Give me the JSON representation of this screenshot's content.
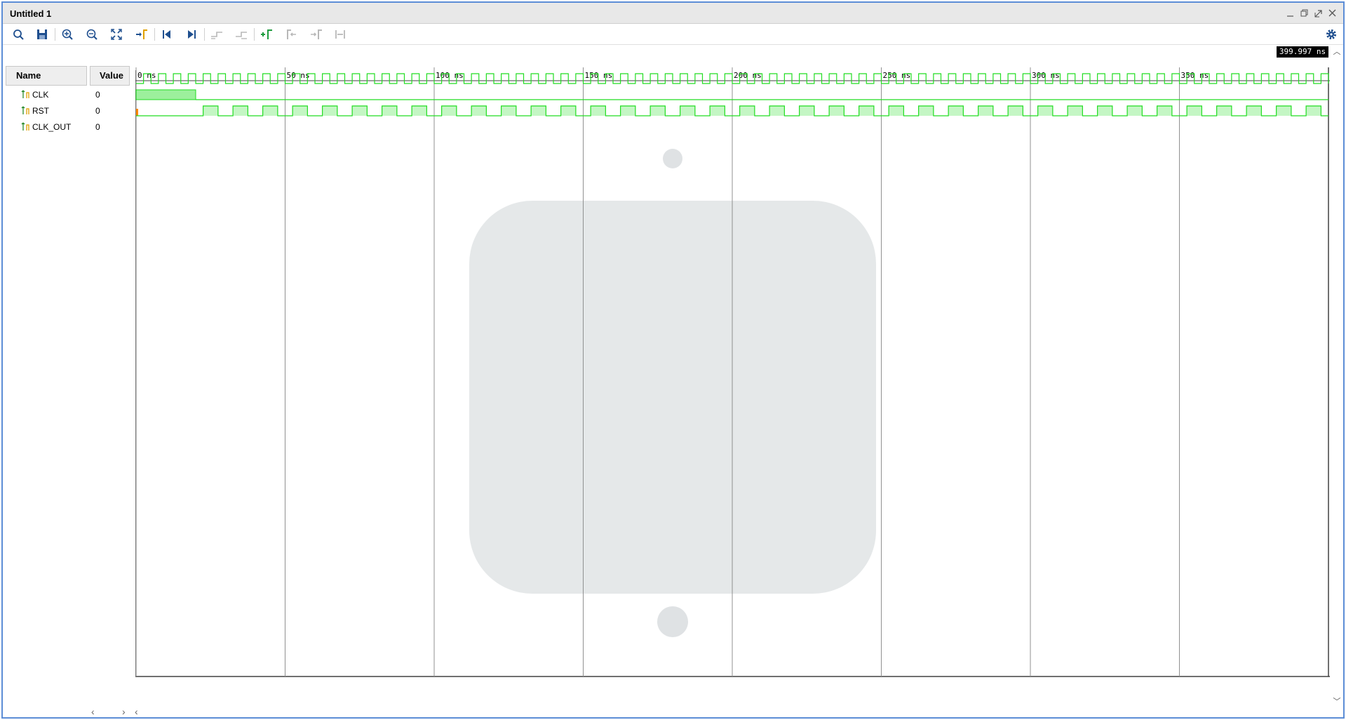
{
  "window": {
    "title": "Untitled 1",
    "controls": [
      "minimize-icon",
      "restore-icon",
      "maximize-icon",
      "close-icon"
    ]
  },
  "toolbar": {
    "buttons": [
      {
        "name": "search-icon",
        "enabled": true
      },
      {
        "name": "save-icon",
        "enabled": true
      },
      {
        "name": "zoom-in-icon",
        "enabled": true
      },
      {
        "name": "zoom-out-icon",
        "enabled": true
      },
      {
        "name": "zoom-fit-icon",
        "enabled": true
      },
      {
        "name": "go-to-cursor-icon",
        "enabled": true
      },
      {
        "name": "go-to-start-icon",
        "enabled": true
      },
      {
        "name": "go-to-end-icon",
        "enabled": true
      },
      {
        "name": "previous-transition-icon",
        "enabled": false
      },
      {
        "name": "next-transition-icon",
        "enabled": false
      },
      {
        "name": "add-marker-icon",
        "enabled": true
      },
      {
        "name": "previous-marker-icon",
        "enabled": false
      },
      {
        "name": "next-marker-icon",
        "enabled": false
      },
      {
        "name": "swap-cursors-icon",
        "enabled": false
      }
    ],
    "settings_icon": "gear-icon"
  },
  "cursor_time": "399.997 ns",
  "columns": {
    "name": "Name",
    "value": "Value"
  },
  "signals": [
    {
      "name": "CLK",
      "value": "0"
    },
    {
      "name": "RST",
      "value": "0"
    },
    {
      "name": "CLK_OUT",
      "value": "0"
    }
  ],
  "timeline": {
    "unit": "ns",
    "start": 0,
    "end": 400,
    "major_step": 50,
    "labels": [
      "0 ns",
      "50 ns",
      "100 ns",
      "150 ns",
      "200 ns",
      "250 ns",
      "300 ns",
      "350 ns"
    ],
    "clk_period_ns": 5,
    "rst_high_until_ns": 20,
    "clk_out_period_ns": 10,
    "clk_out_first_rise_ns": 22.5
  },
  "colors": {
    "wave": "#22dd22",
    "wave_fill": "#9cf09c",
    "grid": "#909090",
    "watermark": "#dfe2e4"
  }
}
